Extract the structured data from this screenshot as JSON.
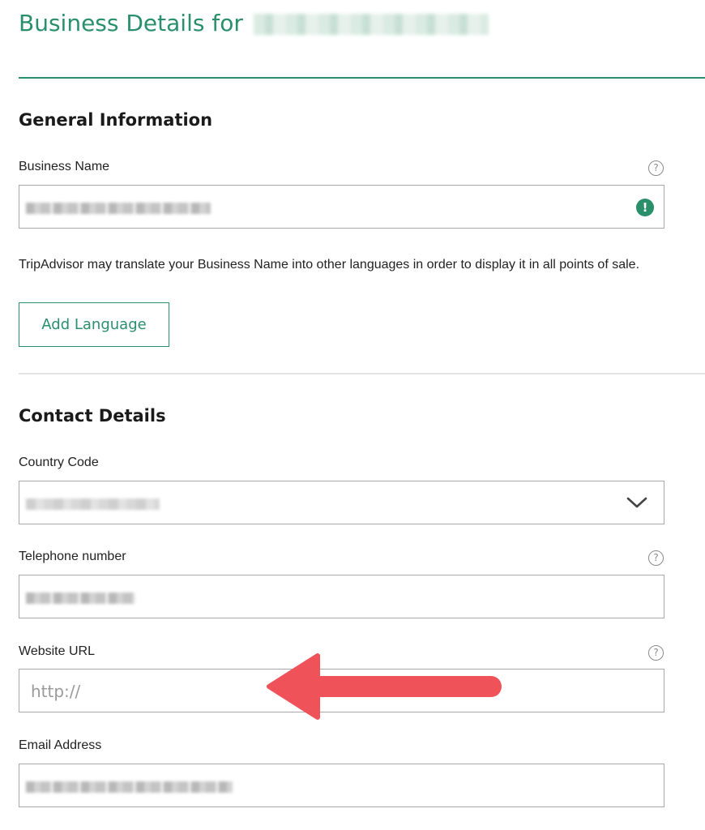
{
  "header": {
    "title_prefix": "Business Details for"
  },
  "general": {
    "section_title": "General Information",
    "business_name_label": "Business Name",
    "help_glyph": "?",
    "status_glyph": "!",
    "note": "TripAdvisor may translate your Business Name into other languages in order to display it in all points of sale.",
    "add_language_label": "Add Language"
  },
  "contact": {
    "section_title": "Contact Details",
    "country_code_label": "Country Code",
    "telephone_label": "Telephone number",
    "website_label": "Website URL",
    "website_placeholder": "http://",
    "email_label": "Email Address"
  },
  "colors": {
    "accent": "#2a8f6b",
    "arrow": "#f0525a"
  },
  "icons": [
    "help-icon",
    "check-status-icon",
    "chevron-down-icon",
    "arrow-annotation-icon"
  ]
}
